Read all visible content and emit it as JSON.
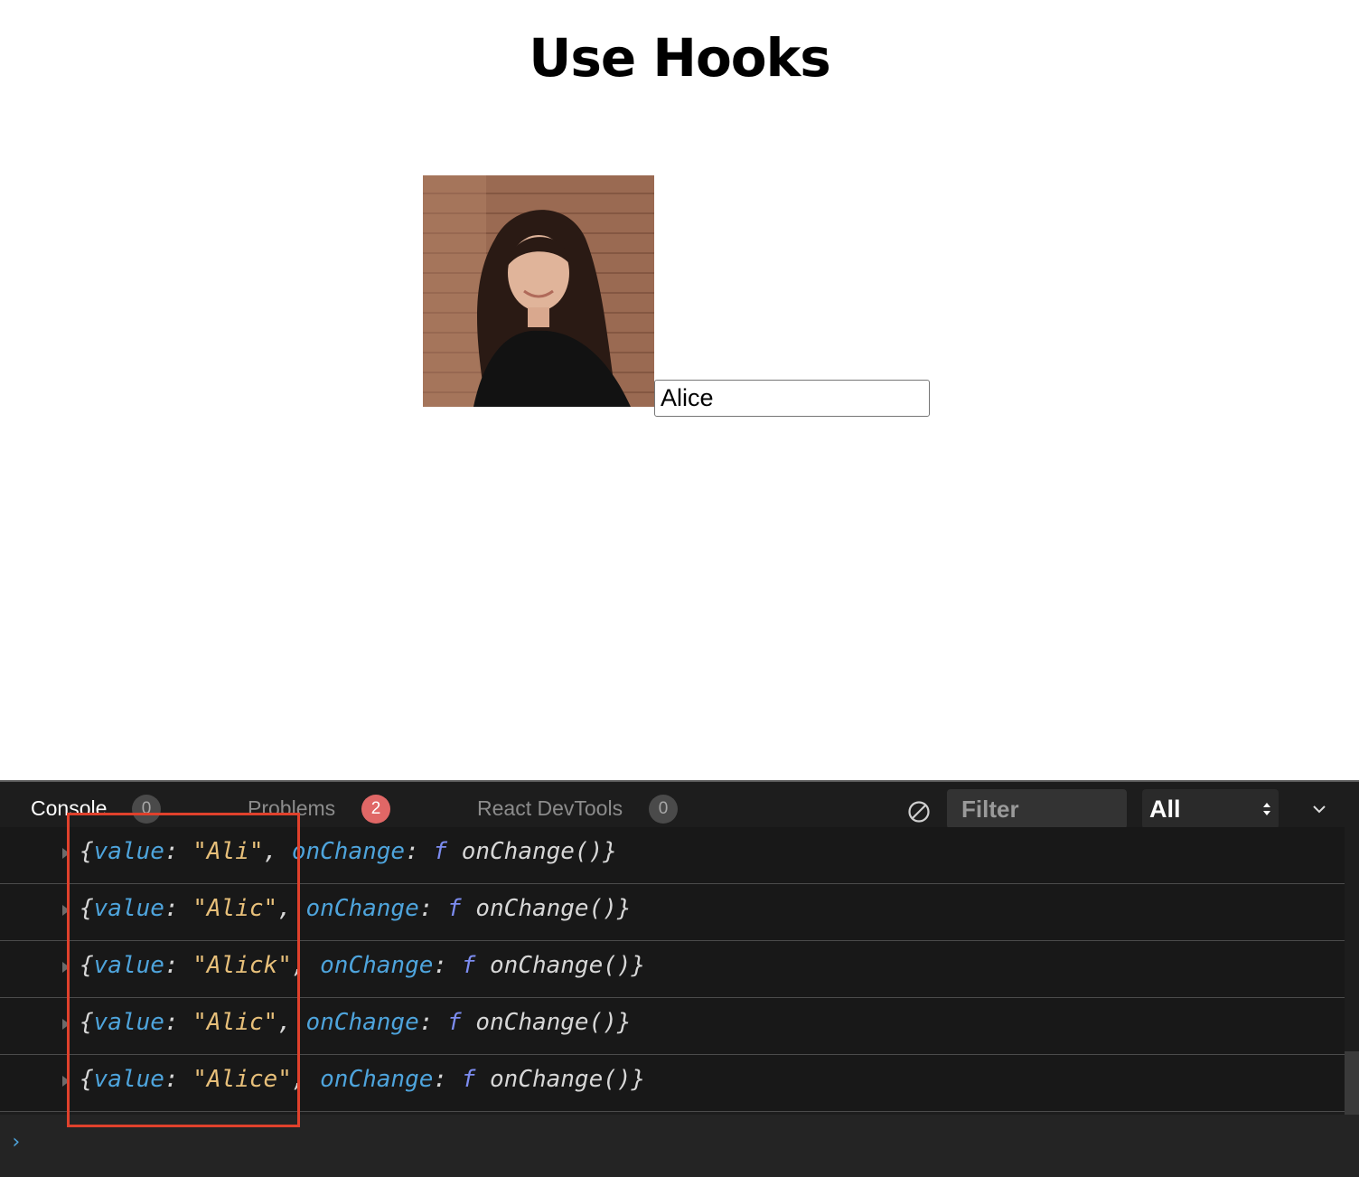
{
  "page": {
    "title": "Use Hooks"
  },
  "profile": {
    "avatar_icon": "person-photo-icon",
    "name_value": "Alice"
  },
  "devtools": {
    "tabs": [
      {
        "label": "Console",
        "count": "0"
      },
      {
        "label": "Problems",
        "count": "2"
      },
      {
        "label": "React DevTools",
        "count": "0"
      }
    ],
    "clear_icon": "clear-console-icon",
    "filter_placeholder": "Filter",
    "level": "All",
    "collapse_icon": "chevron-down-icon",
    "prompt": "›",
    "highlight_color": "#e0412c",
    "logs": [
      {
        "value": "Ali"
      },
      {
        "value": "Alic"
      },
      {
        "value": "Alick"
      },
      {
        "value": "Alic"
      },
      {
        "value": "Alice"
      }
    ],
    "log_template": {
      "open": "{",
      "value_key": "value",
      "colon": ": ",
      "comma": ", ",
      "onchange_key": "onChange",
      "func_symbol": "f",
      "func_name": " onChange()",
      "close": "}"
    }
  }
}
